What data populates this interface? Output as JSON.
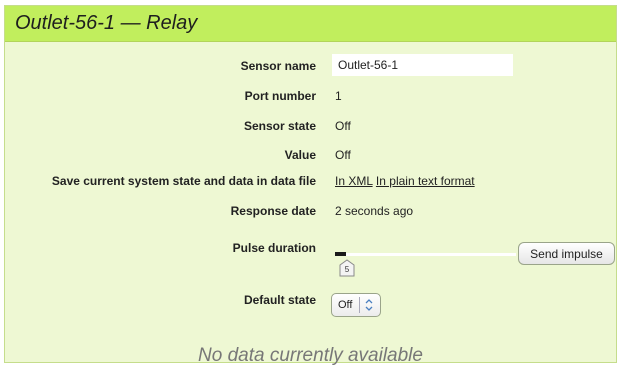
{
  "window": {
    "title": "Outlet-56-1 — Relay"
  },
  "fields": {
    "sensor_name": {
      "label": "Sensor name",
      "value": "Outlet-56-1"
    },
    "port_number": {
      "label": "Port number",
      "value": "1"
    },
    "sensor_state": {
      "label": "Sensor state",
      "value": "Off"
    },
    "value": {
      "label": "Value",
      "value": "Off"
    },
    "save_state": {
      "label": "Save current system state and data in data file",
      "link_xml": "In XML",
      "link_text": "In plain text format"
    },
    "response_date": {
      "label": "Response date",
      "value": "2 seconds ago"
    },
    "pulse_duration": {
      "label": "Pulse duration",
      "slider_value": "5",
      "button_label": "Send impulse"
    },
    "default_state": {
      "label": "Default state",
      "selected": "Off"
    }
  },
  "footer": {
    "message": "No data currently available"
  },
  "colors": {
    "header": "#c1ee5d",
    "panel": "#eef8d3"
  },
  "icons": {
    "slider_handle": "slider-handle-icon",
    "select_arrows": "updown-arrows-icon"
  }
}
